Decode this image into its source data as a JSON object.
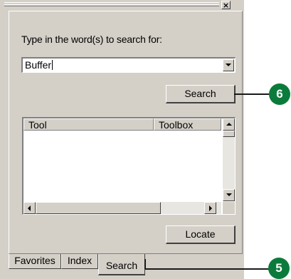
{
  "window": {
    "close_glyph": "×"
  },
  "search_panel": {
    "prompt": "Type in the word(s) to search for:",
    "query_value": "Buffer",
    "search_button": "Search",
    "results": {
      "columns": [
        "Tool",
        "Toolbox"
      ],
      "rows": []
    },
    "locate_button": "Locate"
  },
  "tabs": [
    {
      "label": "Favorites",
      "selected": false
    },
    {
      "label": "Index",
      "selected": false
    },
    {
      "label": "Search",
      "selected": true
    }
  ],
  "callouts": [
    {
      "number": "6",
      "target": "search-button"
    },
    {
      "number": "5",
      "target": "tab-search"
    }
  ],
  "colors": {
    "callout_badge": "#0b7b3b",
    "panel": "#d4d0c8"
  }
}
